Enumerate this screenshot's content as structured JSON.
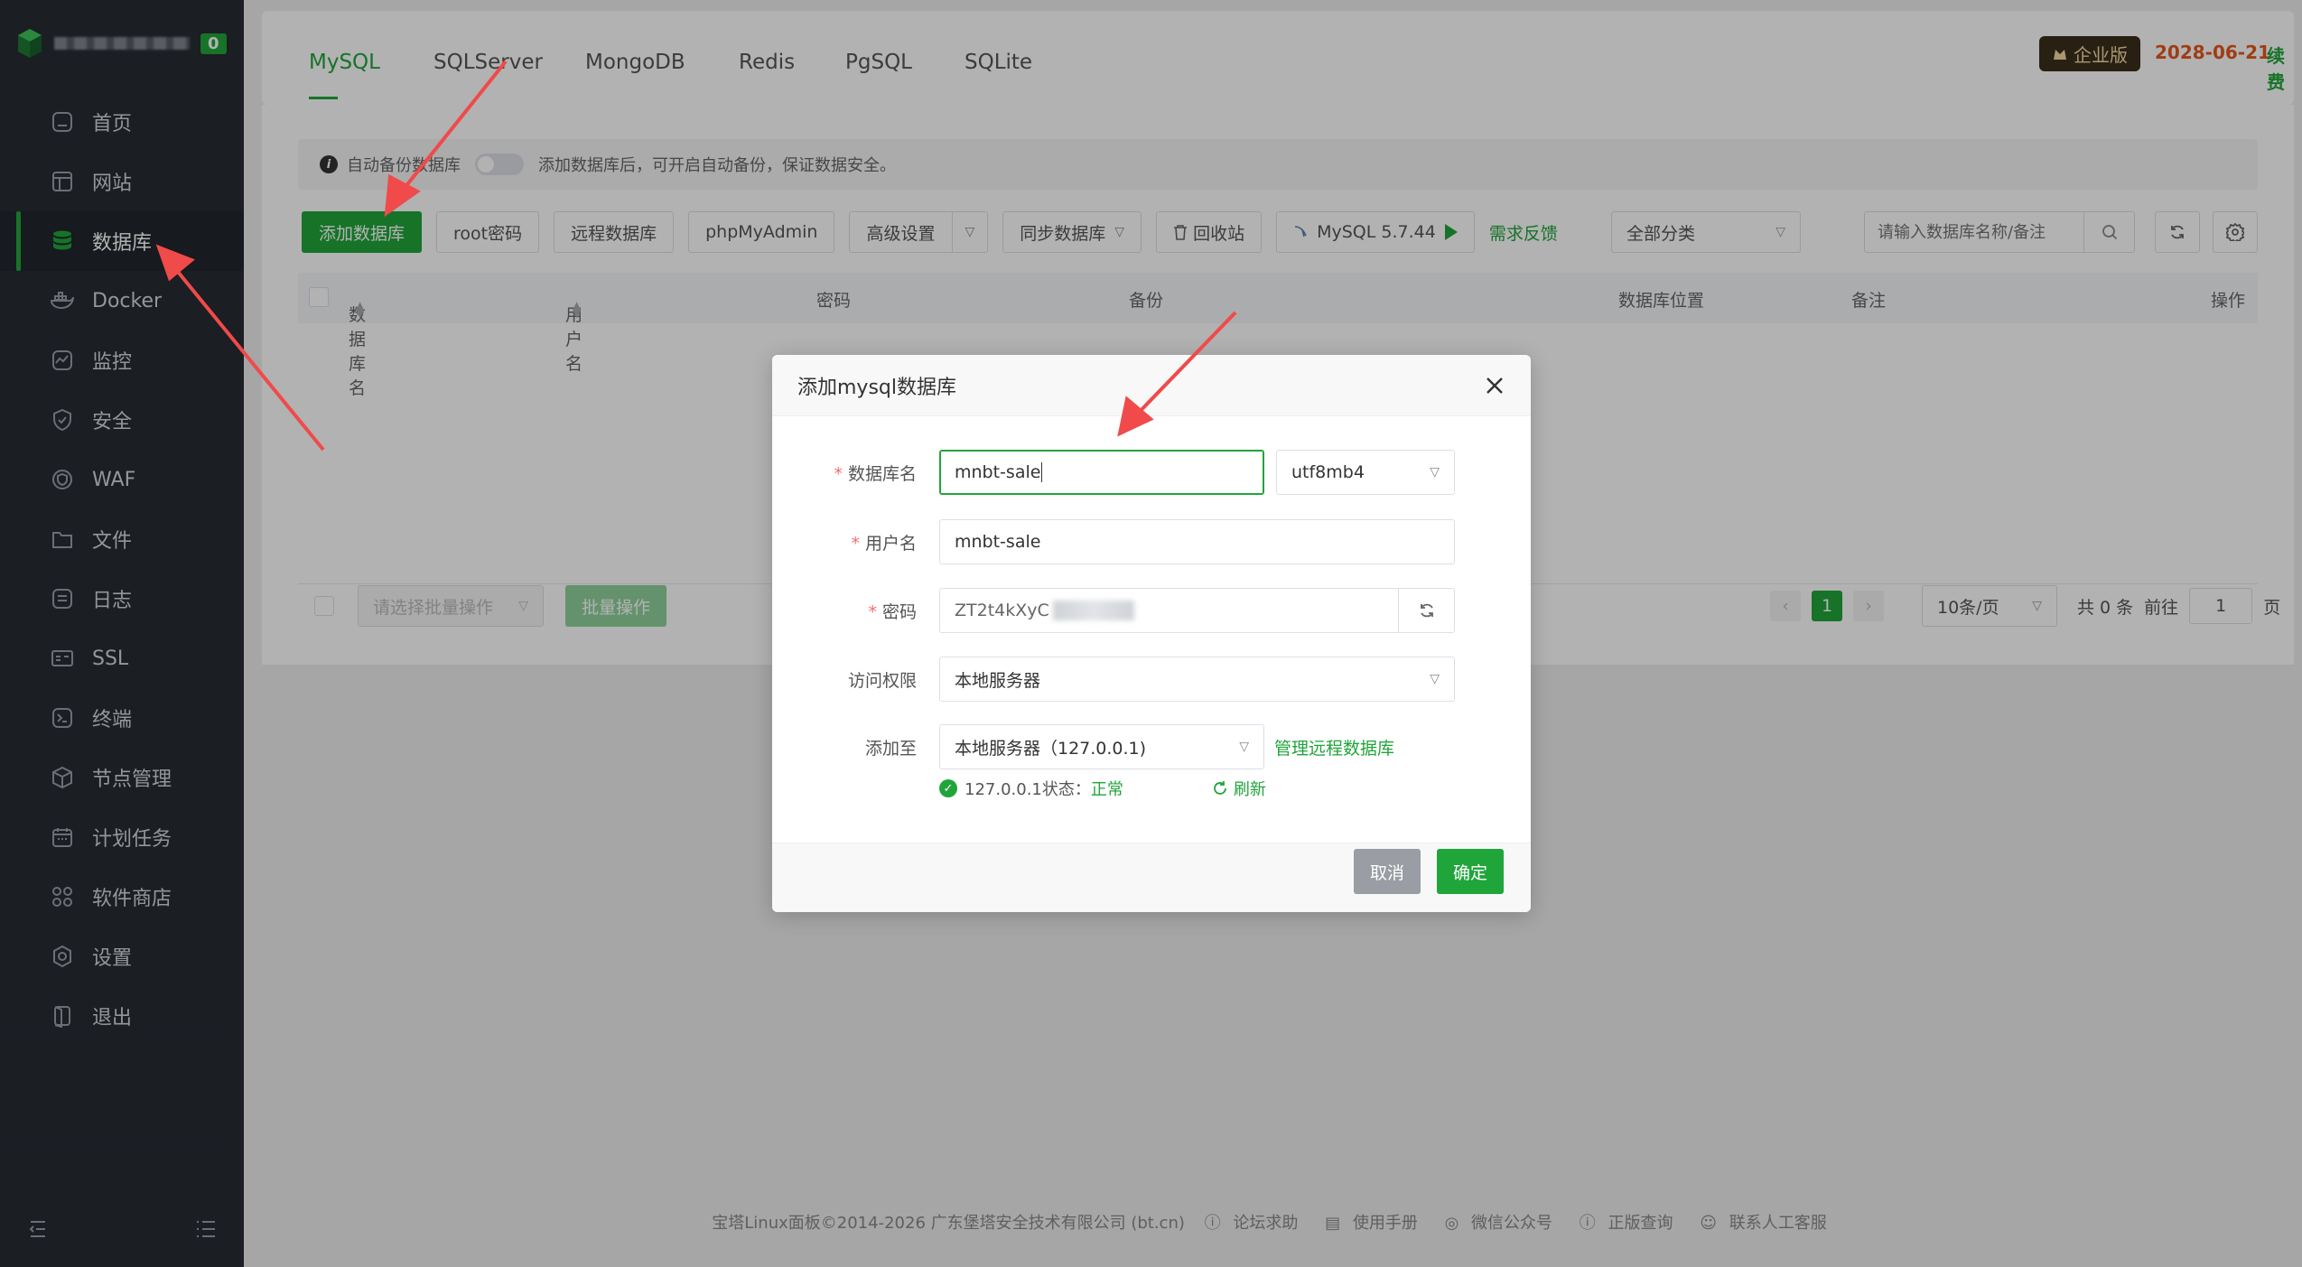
{
  "sidebar": {
    "badge": "0",
    "items": [
      {
        "label": "首页",
        "icon": "home-icon"
      },
      {
        "label": "网站",
        "icon": "website-icon"
      },
      {
        "label": "数据库",
        "icon": "database-icon"
      },
      {
        "label": "Docker",
        "icon": "docker-icon"
      },
      {
        "label": "监控",
        "icon": "monitor-icon"
      },
      {
        "label": "安全",
        "icon": "shield-icon"
      },
      {
        "label": "WAF",
        "icon": "waf-icon"
      },
      {
        "label": "文件",
        "icon": "folder-icon"
      },
      {
        "label": "日志",
        "icon": "log-icon"
      },
      {
        "label": "SSL",
        "icon": "ssl-icon"
      },
      {
        "label": "终端",
        "icon": "terminal-icon"
      },
      {
        "label": "节点管理",
        "icon": "node-icon"
      },
      {
        "label": "计划任务",
        "icon": "calendar-icon"
      },
      {
        "label": "软件商店",
        "icon": "store-icon"
      },
      {
        "label": "设置",
        "icon": "settings-icon"
      },
      {
        "label": "退出",
        "icon": "logout-icon"
      }
    ]
  },
  "tabs": [
    "MySQL",
    "SQLServer",
    "MongoDB",
    "Redis",
    "PgSQL",
    "SQLite"
  ],
  "header": {
    "edition": "企业版",
    "expire_date": "2028-06-21",
    "renew": "续费"
  },
  "notice": {
    "label": "自动备份数据库",
    "text": "添加数据库后，可开启自动备份，保证数据安全。"
  },
  "toolbar": {
    "add": "添加数据库",
    "root_pwd": "root密码",
    "remote_db": "远程数据库",
    "phpmyadmin": "phpMyAdmin",
    "advanced": "高级设置",
    "sync": "同步数据库",
    "recycle": "回收站",
    "version": "MySQL 5.7.44",
    "feedback": "需求反馈",
    "category": "全部分类",
    "search_placeholder": "请输入数据库名称/备注"
  },
  "table": {
    "columns": [
      "数据库名",
      "用户名",
      "密码",
      "备份",
      "数据库位置",
      "备注",
      "操作"
    ]
  },
  "bottom": {
    "batch_placeholder": "请选择批量操作",
    "batch_btn": "批量操作",
    "page": "1",
    "page_size": "10条/页",
    "total": "共 0 条",
    "goto": "前往",
    "goto_value": "1",
    "page_unit": "页"
  },
  "footer": {
    "copyright": "宝塔Linux面板©2014-2026 广东堡塔安全技术有限公司 (bt.cn)",
    "links": [
      "论坛求助",
      "使用手册",
      "微信公众号",
      "正版查询",
      "联系人工客服"
    ]
  },
  "modal": {
    "title": "添加mysql数据库",
    "db_name_label": "数据库名",
    "db_name_value": "mnbt-sale",
    "charset": "utf8mb4",
    "user_label": "用户名",
    "user_value": "mnbt-sale",
    "pwd_label": "密码",
    "pwd_value": "ZT2t4kXyC",
    "access_label": "访问权限",
    "access_value": "本地服务器",
    "addto_label": "添加至",
    "addto_value": "本地服务器（127.0.0.1)",
    "manage_remote": "管理远程数据库",
    "status_label": "127.0.0.1状态：",
    "status_value": "正常",
    "refresh": "刷新",
    "cancel": "取消",
    "confirm": "确定"
  },
  "colors": {
    "accent": "#20a53a",
    "sidebar_bg": "#272c33",
    "arrow": "#f04a4a",
    "expire": "#e6561e"
  }
}
